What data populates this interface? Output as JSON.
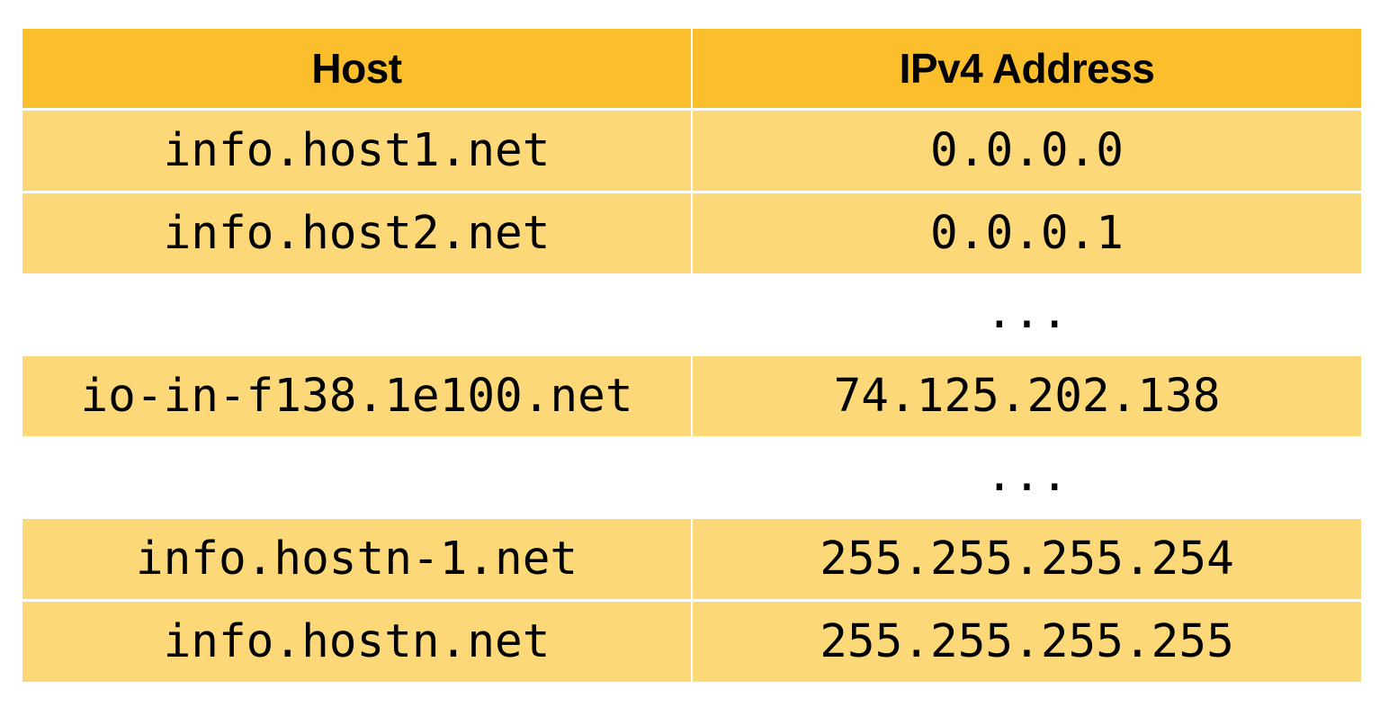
{
  "table": {
    "headers": {
      "host": "Host",
      "ip": "IPv4 Address"
    },
    "rows": [
      {
        "type": "data",
        "host": "info.host1.net",
        "ip": "0.0.0.0"
      },
      {
        "type": "data",
        "host": "info.host2.net",
        "ip": "0.0.0.1"
      },
      {
        "type": "gap",
        "host": "",
        "ip": "..."
      },
      {
        "type": "data",
        "host": "io-in-f138.1e100.net",
        "ip": "74.125.202.138"
      },
      {
        "type": "gap",
        "host": "",
        "ip": "..."
      },
      {
        "type": "data",
        "host": "info.hostn-1.net",
        "ip": "255.255.255.254"
      },
      {
        "type": "data",
        "host": "info.hostn.net",
        "ip": "255.255.255.255"
      }
    ]
  },
  "colors": {
    "header_bg": "#fbbf2e",
    "row_bg": "#fcd878",
    "text": "#000000"
  }
}
